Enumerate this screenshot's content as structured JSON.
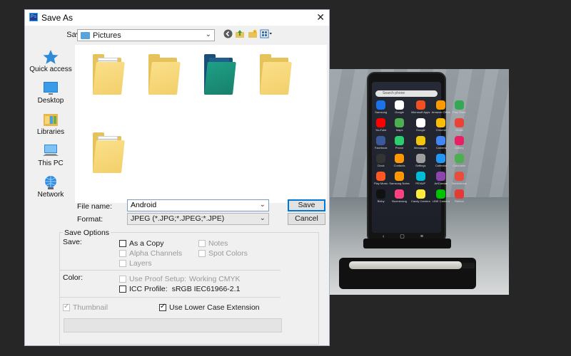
{
  "dialog": {
    "app_icon": "Ps",
    "title": "Save As",
    "close_glyph": "✕"
  },
  "toolbar": {
    "save_in_label": "Save in:",
    "save_in_value": "Pictures",
    "icons": [
      "back-icon",
      "up-folder-icon",
      "new-folder-icon",
      "view-menu-icon"
    ]
  },
  "places": [
    {
      "label": "Quick access",
      "icon": "star-icon"
    },
    {
      "label": "Desktop",
      "icon": "desktop-icon"
    },
    {
      "label": "Libraries",
      "icon": "libraries-icon"
    },
    {
      "label": "This PC",
      "icon": "this-pc-icon"
    },
    {
      "label": "Network",
      "icon": "network-icon"
    }
  ],
  "files": {
    "folder_count_shown": 5
  },
  "form": {
    "file_name_label": "File name:",
    "file_name_value": "Android",
    "format_label": "Format:",
    "format_value": "JPEG (*.JPG;*.JPEG;*.JPE)",
    "save_button": "Save",
    "cancel_button": "Cancel"
  },
  "save_options": {
    "heading": "Save Options",
    "save_label": "Save:",
    "as_a_copy": "As a Copy",
    "alpha_channels": "Alpha Channels",
    "layers": "Layers",
    "notes": "Notes",
    "spot_colors": "Spot Colors",
    "color_label": "Color:",
    "use_proof_setup": "Use Proof Setup:",
    "working_cmyk": "Working CMYK",
    "icc_profile": "ICC Profile:",
    "icc_value": "sRGB IEC61966-2.1",
    "thumbnail": "Thumbnail",
    "lower_case_ext": "Use Lower Case Extension"
  },
  "phone_screen": {
    "search_placeholder": "Search phone",
    "apps": [
      "Samsung",
      "Google",
      "Microsoft Apps",
      "Amazon Office",
      "Play Store",
      "YouTube",
      "Maps",
      "Google",
      "Chrome",
      "Gmail",
      "Facebook",
      "Phone",
      "Messages",
      "Camera",
      "Gallery",
      "Clock",
      "Contacts",
      "Settings",
      "Calendar",
      "Calculator",
      "Play Music",
      "Samsung Notes",
      "PENUP",
      "ArtCanvas",
      "Sketchbook",
      "Bixby",
      "Boomerang",
      "Candy Camera",
      "LINE Camera",
      "Retrica"
    ]
  },
  "colors": {
    "accent": "#0078d7",
    "background": "#262626",
    "dialog": "#f0f0f0"
  }
}
